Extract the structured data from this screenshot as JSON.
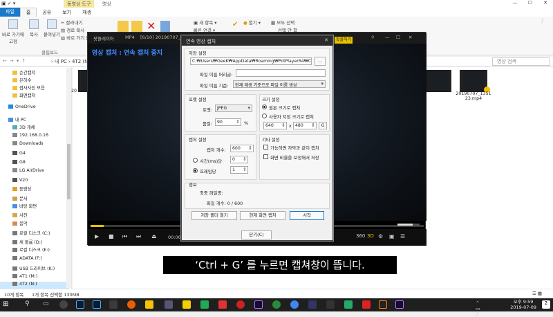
{
  "explorer": {
    "context_tab": "동영상 도구",
    "window_title": "영상",
    "tabs": [
      "파일",
      "홈",
      "공유",
      "보기",
      "재생"
    ],
    "ribbon": {
      "pin": "바로 가기에\n고정",
      "copy": "복사",
      "paste": "붙여넣기",
      "cut": "잘라내기",
      "copy_path": "경로 복사",
      "paste_shortcut": "바로 가기 붙",
      "clipboard_group": "클립보드",
      "new_item": "새 항목 ▾",
      "easy_access": "빠른 연결 ▾",
      "open": "열기 ▾",
      "select_all": "모두 선택",
      "select_none": "선택 안 함"
    },
    "address": {
      "path": "› 내 PC › 4T2 (N:) ›",
      "search_placeholder": "영상 검색"
    },
    "nav_items": [
      {
        "label": "순간캡쳐",
        "icon": "folder-icon"
      },
      {
        "label": "은하수",
        "icon": "folder-icon"
      },
      {
        "label": "접사사진 모음",
        "icon": "folder-icon"
      },
      {
        "label": "화면캡쳐",
        "icon": "folder-icon"
      },
      {
        "label": "OneDrive",
        "icon": "cloud-icon"
      },
      {
        "label": "내 PC",
        "icon": "pc-icon"
      },
      {
        "label": "3D 개체",
        "icon": "cube-icon"
      },
      {
        "label": "192.168.0.16",
        "icon": "drive-icon"
      },
      {
        "label": "Downloads",
        "icon": "drive-icon"
      },
      {
        "label": "G4",
        "icon": "phone-icon"
      },
      {
        "label": "G8",
        "icon": "phone-icon"
      },
      {
        "label": "LG AirDrive",
        "icon": "drive-icon"
      },
      {
        "label": "V20",
        "icon": "phone-icon"
      },
      {
        "label": "동영상",
        "icon": "video-folder-icon"
      },
      {
        "label": "문서",
        "icon": "document-folder-icon"
      },
      {
        "label": "바탕 화면",
        "icon": "desktop-folder-icon"
      },
      {
        "label": "사진",
        "icon": "picture-folder-icon"
      },
      {
        "label": "음악",
        "icon": "music-folder-icon"
      },
      {
        "label": "로컬 디스크 (C:)",
        "icon": "disk-icon"
      },
      {
        "label": "새 볼륨 (D:)",
        "icon": "disk-icon"
      },
      {
        "label": "로컬 디스크 (E:)",
        "icon": "disk-icon"
      },
      {
        "label": "ADATA (F:)",
        "icon": "disk-icon"
      },
      {
        "label": "USB 드라이브 (K:)",
        "icon": "usb-icon"
      },
      {
        "label": "4T1 (M:)",
        "icon": "disk-icon"
      },
      {
        "label": "4T2 (N:)",
        "icon": "disk-icon"
      }
    ],
    "files": [
      {
        "label": "20"
      },
      {
        "label": "7"
      },
      {
        "label": "20190707_1351\n23.mp4"
      }
    ],
    "status": {
      "count": "10개 항목",
      "selected": "1개 항목 선택함 130MB"
    }
  },
  "player": {
    "app_name": "팟플레이어",
    "format": "MP4",
    "file": "[6/10] 20190707_1",
    "capture_status": "영상 캡처 : 연속 캡처 중지",
    "time": "00:00:0",
    "badge": "팟플하기"
  },
  "dialog": {
    "title": "연속 영상 캡처",
    "save": {
      "section": "저장 설정",
      "path": "C:₩Users₩GeeK₩AppData₩Roaming₩PotPlayer64₩Capture",
      "browse": "...",
      "prefix_label": "파일 이름 머리글:",
      "prefix_value": "",
      "basis_label": "파일 이름 기준:",
      "basis_value": "현재 재생 기준으로 파일 이름 생성"
    },
    "format": {
      "section": "포맷 설정",
      "format_label": "포맷:",
      "format_value": "JPEG",
      "quality_label": "품질:",
      "quality_value": "90",
      "quality_unit": "%"
    },
    "size": {
      "section": "크기 설정",
      "original": "원본 크기로 캡처",
      "custom": "사용자 지정 크기로 캡처",
      "width": "640",
      "x": "x",
      "height": "480",
      "g": "G"
    },
    "capture": {
      "section": "캡처 설정",
      "count_label": "캡처 개수:",
      "count_value": "600",
      "time_label": "시간(ms)당",
      "time_value": "0",
      "frame_label": "프레임당",
      "frame_value": "1"
    },
    "other": {
      "section": "기타 설정",
      "option1": "가능하면 자막과 같이 캡처",
      "option2": "화면 비율을 보정해서 저장"
    },
    "info": {
      "section": "정보",
      "last_file": "최종 파일명:",
      "file_count": "파일 개수:  0 / 600"
    },
    "buttons": {
      "open_folder": "저장 폴더 열기",
      "capture_now": "현재 화면 캡처",
      "start": "시작",
      "close": "닫기(C)"
    }
  },
  "subtitle": "‘Ctrl + G’ 를 누르면 캡쳐창이 뜹니다.",
  "taskbar": {
    "time": "오후 9:59",
    "date": "2019-07-09",
    "notif_count": "2"
  }
}
